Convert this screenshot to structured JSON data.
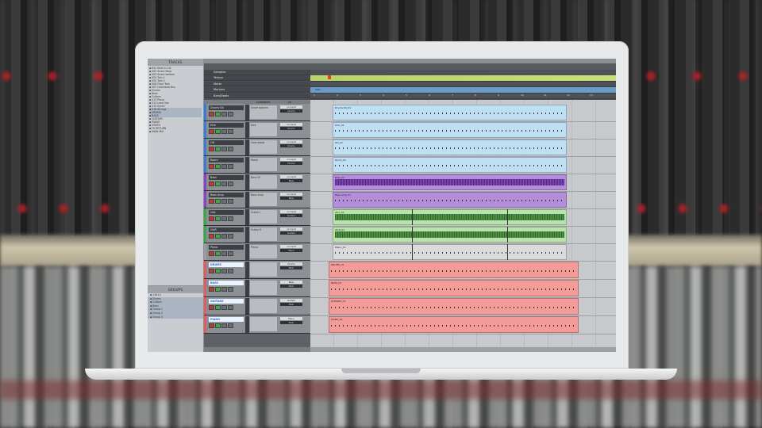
{
  "left_panel": {
    "tracks_title": "TRACKS",
    "tracks": [
      "001 Shot In Clk",
      "002 Snare Reso",
      "003 Snare bottom",
      "004 Tom 1",
      "005 Tom 2",
      "006 Floor Tom",
      "007 Overhead Bus",
      "Drums",
      "Bass",
      "Guitars",
      "013 Piano",
      "014 Lead Vox",
      "015 Synth",
      "016 Strings",
      "DRUMS",
      "BASS",
      "GUITARS",
      "PIANO",
      "SYNTH",
      "FX RETURN",
      "MAIN MIX"
    ],
    "groups_title": "GROUPS",
    "groups": [
      "<ALL>",
      "Drums",
      "Guitars",
      "Bass",
      "Group 1",
      "Group 2",
      "Group 3"
    ]
  },
  "rulers": {
    "labels": [
      "Samples",
      "Tempo",
      "Meter",
      "Markers",
      "Bars|Beats"
    ],
    "ticks": [
      "1",
      "2",
      "3",
      "4",
      "5",
      "6",
      "7",
      "8",
      "9",
      "10",
      "11",
      "12",
      "13"
    ],
    "marker_label": "Intro"
  },
  "header_cols": {
    "comments": "COMMENTS",
    "io": "I/O"
  },
  "tracks": [
    {
      "name": "Drums Kit",
      "comment": "Snare bottom",
      "io": [
        "no input",
        "Drums"
      ],
      "color": "#3a7bd5"
    },
    {
      "name": "Kick",
      "comment": "Kick",
      "io": [
        "no input",
        "Drums"
      ],
      "color": "#3a7bd5"
    },
    {
      "name": "OH",
      "comment": "Overheads",
      "io": [
        "no input",
        "Drums"
      ],
      "color": "#3a7bd5"
    },
    {
      "name": "Room",
      "comment": "Room",
      "io": [
        "no input",
        "Drums"
      ],
      "color": "#3a7bd5"
    },
    {
      "name": "Bass",
      "comment": "Bass DI",
      "io": [
        "no input",
        "Bass"
      ],
      "color": "#8a3fc4"
    },
    {
      "name": "Bass Amp",
      "comment": "Bass Amp",
      "io": [
        "no input",
        "Bass"
      ],
      "color": "#8a3fc4"
    },
    {
      "name": "GtrL",
      "comment": "Guitar L",
      "io": [
        "no input",
        "Guitars"
      ],
      "color": "#39a845"
    },
    {
      "name": "GtrR",
      "comment": "Guitar R",
      "io": [
        "no input",
        "Guitars"
      ],
      "color": "#39a845"
    },
    {
      "name": "Piano",
      "comment": "Piano",
      "io": [
        "no input",
        "Piano"
      ],
      "color": "#9a9da0"
    },
    {
      "name": "DRUMS",
      "comment": "",
      "io": [
        "Drums",
        "Main"
      ],
      "color": "#e35b5b",
      "colored": true
    },
    {
      "name": "BASS",
      "comment": "",
      "io": [
        "Bass",
        "Main"
      ],
      "color": "#e35b5b",
      "colored": true
    },
    {
      "name": "GUITARS",
      "comment": "",
      "io": [
        "Guitars",
        "Main"
      ],
      "color": "#e35b5b",
      "colored": true
    },
    {
      "name": "PIANO",
      "comment": "",
      "io": [
        "Piano",
        "Main"
      ],
      "color": "#e35b5b",
      "colored": true
    }
  ],
  "clips": {
    "blue": "#bfe0f2",
    "purple": "#b48ddb",
    "green": "#b9e3ad",
    "grey": "#d9dadb",
    "red": "#f29b99"
  }
}
